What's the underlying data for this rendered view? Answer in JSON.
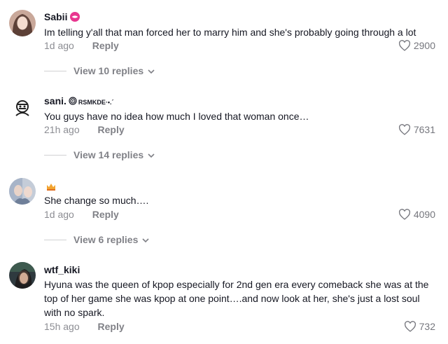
{
  "comments": [
    {
      "username": "Sabii",
      "badge_icon": "lips-icon",
      "text": "Im telling y'all that man forced her to marry him and she's probably going through a lot",
      "time": "1d ago",
      "reply_label": "Reply",
      "likes": "2900",
      "view_replies": "View 10 replies"
    },
    {
      "username": "sani.",
      "username_suffix": "RSMKDE·•.´",
      "badge_icon": "spiral-icon",
      "text": "You guys have no idea how much I loved that woman once…",
      "time": "21h ago",
      "reply_label": "Reply",
      "likes": "7631",
      "view_replies": "View 14 replies"
    },
    {
      "username": "",
      "badge_icon": "crown-icon",
      "text": "She change so much….",
      "time": "1d ago",
      "reply_label": "Reply",
      "likes": "4090",
      "view_replies": "View 6 replies"
    },
    {
      "username": "wtf_kiki",
      "text": "Hyuna was the queen of kpop especially for 2nd gen era every comeback she was at the top of her game she was kpop at one point….and now look at her, she's just a lost soul with no spark.",
      "time": "15h ago",
      "reply_label": "Reply",
      "likes": "732"
    }
  ]
}
